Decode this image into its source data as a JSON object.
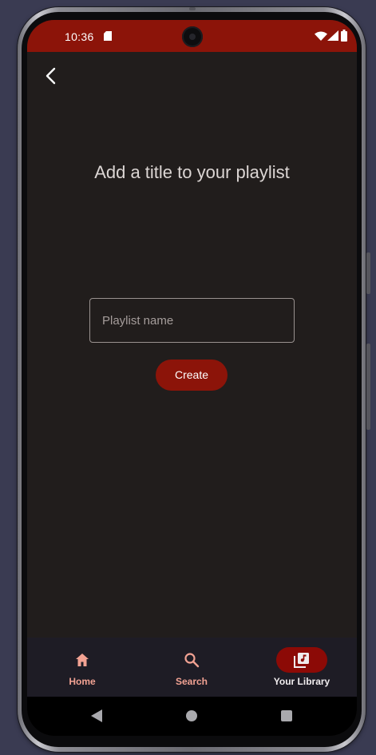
{
  "status_bar": {
    "time": "10:36",
    "icons": [
      "sd-card-icon",
      "camera-cutout",
      "wifi-icon",
      "signal-icon",
      "battery-icon"
    ]
  },
  "colors": {
    "accent": "#8c1409",
    "background": "#211d1c",
    "nav_background": "#1e1c25",
    "nav_label": "#f2a293",
    "nav_active_pill": "#8c0a06"
  },
  "header": {
    "back_icon": "chevron-left-icon"
  },
  "main": {
    "title": "Add a title to your playlist",
    "playlist_name_placeholder": "Playlist name",
    "playlist_name_value": "",
    "create_label": "Create"
  },
  "bottom_nav": {
    "items": [
      {
        "label": "Home",
        "icon": "home-icon",
        "active": false
      },
      {
        "label": "Search",
        "icon": "search-icon",
        "active": false
      },
      {
        "label": "Your Library",
        "icon": "library-music-icon",
        "active": true
      }
    ]
  },
  "system_nav": {
    "buttons": [
      "back-triangle-icon",
      "home-circle-icon",
      "recents-square-icon"
    ]
  }
}
